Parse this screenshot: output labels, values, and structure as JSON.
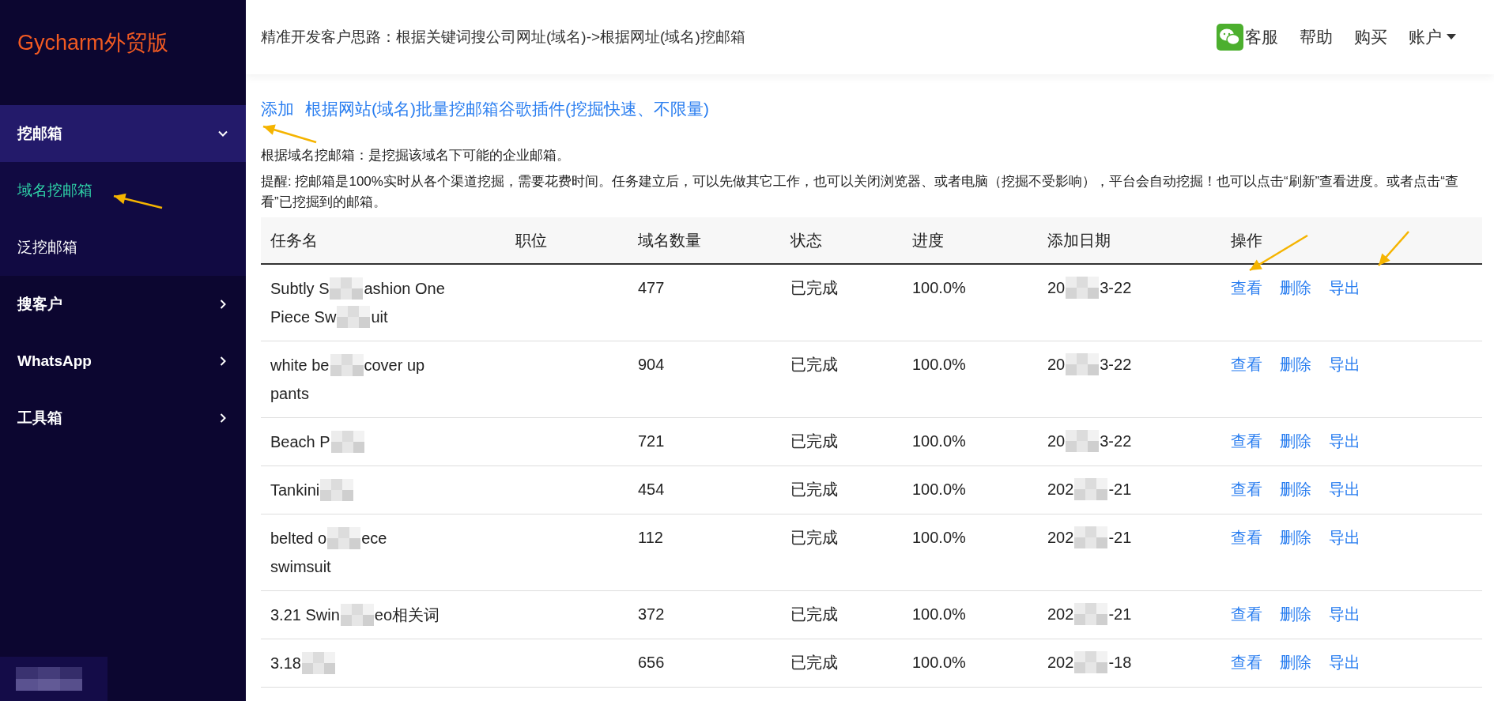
{
  "sidebar": {
    "logo": "Gycharm外贸版",
    "items": [
      {
        "label": "挖邮箱",
        "expanded": true,
        "children": [
          {
            "label": "域名挖邮箱",
            "selected": true
          },
          {
            "label": "泛挖邮箱",
            "selected": false
          }
        ]
      },
      {
        "label": "搜客户",
        "expanded": false
      },
      {
        "label": "WhatsApp",
        "expanded": false
      },
      {
        "label": "工具箱",
        "expanded": false
      }
    ]
  },
  "header": {
    "title": "精准开发客户思路：根据关键词搜公司网址(域名)->根据网址(域名)挖邮箱",
    "nav": [
      "客服",
      "帮助",
      "购买",
      "账户"
    ]
  },
  "add_link": {
    "action": "添加",
    "label": "根据网站(域名)批量挖邮箱谷歌插件(挖掘快速、不限量)"
  },
  "description": "根据域名挖邮箱：是挖掘该域名下可能的企业邮箱。",
  "notice": "提醒: 挖邮箱是100%实时从各个渠道挖掘，需要花费时间。任务建立后，可以先做其它工作，也可以关闭浏览器、或者电脑（挖掘不受影响），平台会自动挖掘！也可以点击“刷新”查看进度。或者点击“查看”已挖掘到的邮箱。",
  "table": {
    "columns": [
      "任务名",
      "职位",
      "域名数量",
      "状态",
      "进度",
      "添加日期",
      "操作"
    ],
    "rows": [
      {
        "name_lines": [
          [
            "Subtly S",
            "ashion One"
          ],
          [
            "Piece Sw",
            "uit"
          ]
        ],
        "count": "477",
        "status": "已完成",
        "progress": "100.0%",
        "date_parts": [
          "20",
          "3-22"
        ],
        "actions": [
          "查看",
          "删除",
          "导出"
        ]
      },
      {
        "name_lines": [
          [
            "white be",
            "cover up"
          ],
          [
            "pants"
          ]
        ],
        "count": "904",
        "status": "已完成",
        "progress": "100.0%",
        "date_parts": [
          "20",
          "3-22"
        ],
        "actions": [
          "查看",
          "删除",
          "导出"
        ]
      },
      {
        "name_lines": [
          [
            "Beach P"
          ]
        ],
        "count": "721",
        "status": "已完成",
        "progress": "100.0%",
        "date_parts": [
          "20",
          "3-22"
        ],
        "actions": [
          "查看",
          "删除",
          "导出"
        ]
      },
      {
        "name_lines": [
          [
            "Tankini"
          ]
        ],
        "count": "454",
        "status": "已完成",
        "progress": "100.0%",
        "date_parts": [
          "202",
          "-21"
        ],
        "actions": [
          "查看",
          "删除",
          "导出"
        ]
      },
      {
        "name_lines": [
          [
            "belted o",
            "ece"
          ],
          [
            "swimsuit"
          ]
        ],
        "count": "112",
        "status": "已完成",
        "progress": "100.0%",
        "date_parts": [
          "202",
          "-21"
        ],
        "actions": [
          "查看",
          "删除",
          "导出"
        ]
      },
      {
        "name_lines": [
          [
            "3.21 Swin",
            "eo相关词"
          ]
        ],
        "count": "372",
        "status": "已完成",
        "progress": "100.0%",
        "date_parts": [
          "202",
          "-21"
        ],
        "actions": [
          "查看",
          "删除",
          "导出"
        ]
      },
      {
        "name_lines": [
          [
            "3.18"
          ]
        ],
        "count": "656",
        "status": "已完成",
        "progress": "100.0%",
        "date_parts": [
          "202",
          "-18"
        ],
        "actions": [
          "查看",
          "删除",
          "导出"
        ]
      }
    ]
  }
}
